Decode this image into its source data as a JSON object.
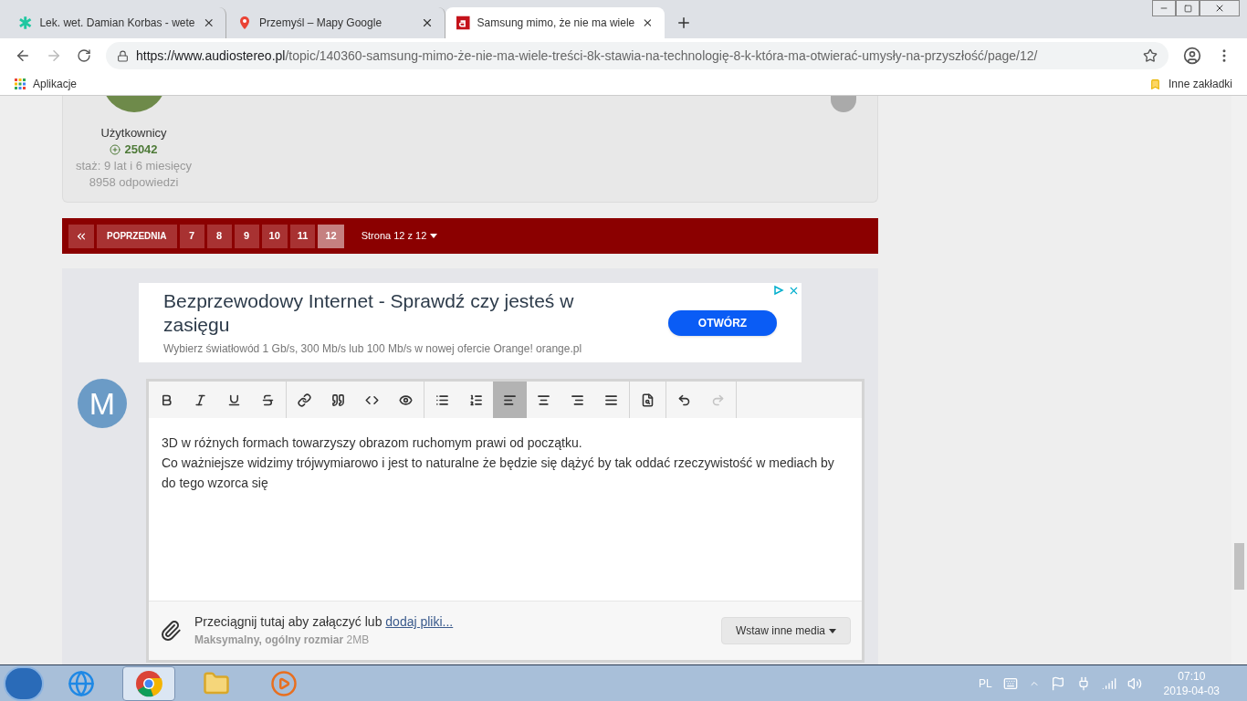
{
  "browser": {
    "tabs": [
      {
        "title": "Lek. wet. Damian Korbas - wete",
        "kind": "vet",
        "selected": false
      },
      {
        "title": "Przemyśl – Mapy Google",
        "kind": "maps",
        "selected": false
      },
      {
        "title": "Samsung mimo, że nie ma wiele",
        "kind": "site",
        "selected": true
      }
    ],
    "url_host": "https://www.audiostereo.pl",
    "url_path": "/topic/140360-samsung-mimo-że-nie-ma-wiele-treści-8k-stawia-na-technologię-8-k-która-ma-otwierać-umysły-na-przyszłość/page/12/",
    "bookmarks": [
      {
        "label": "Aplikacje",
        "kind": "apps"
      }
    ],
    "other_bookmarks": "Inne zakładki"
  },
  "user_card": {
    "group": "Użytkownicy",
    "reputation": "25042",
    "tenure": "staż: 9 lat i 6 miesięcy",
    "replies": "8958 odpowiedzi"
  },
  "pagination": {
    "prev": "POPRZEDNIA",
    "pages": [
      {
        "label": "7",
        "selected": false
      },
      {
        "label": "8",
        "selected": false
      },
      {
        "label": "9",
        "selected": false
      },
      {
        "label": "10",
        "selected": false
      },
      {
        "label": "11",
        "selected": false
      },
      {
        "label": "12",
        "selected": true
      }
    ],
    "page_info": "Strona 12 z 12"
  },
  "ad": {
    "title": "Bezprzewodowy Internet - Sprawdź czy jesteś w zasięgu",
    "text": "Wybierz światłowód 1 Gb/s, 300 Mb/s lub 100 Mb/s w nowej ofercie Orange! orange.pl",
    "button": "OTWÓRZ"
  },
  "editor": {
    "avatar_letter": "M",
    "toolbar": [
      [
        {
          "kind": "bold",
          "selected": false,
          "disabled": false
        },
        {
          "kind": "italic",
          "selected": false,
          "disabled": false
        },
        {
          "kind": "underline",
          "selected": false,
          "disabled": false
        },
        {
          "kind": "strike",
          "selected": false,
          "disabled": false
        }
      ],
      [
        {
          "kind": "link",
          "selected": false,
          "disabled": false
        },
        {
          "kind": "quote",
          "selected": false,
          "disabled": false
        },
        {
          "kind": "code",
          "selected": false,
          "disabled": false
        },
        {
          "kind": "spoiler",
          "selected": false,
          "disabled": false
        }
      ],
      [
        {
          "kind": "bullets",
          "selected": false,
          "disabled": false
        },
        {
          "kind": "numbers",
          "selected": false,
          "disabled": false
        },
        {
          "kind": "align_left",
          "selected": true,
          "disabled": false
        },
        {
          "kind": "align_center",
          "selected": false,
          "disabled": false
        },
        {
          "kind": "align_right",
          "selected": false,
          "disabled": false
        },
        {
          "kind": "justify",
          "selected": false,
          "disabled": false
        }
      ],
      [
        {
          "kind": "preview",
          "selected": false,
          "disabled": false
        }
      ],
      [
        {
          "kind": "undo",
          "selected": false,
          "disabled": false
        },
        {
          "kind": "redo",
          "selected": false,
          "disabled": true
        }
      ]
    ],
    "lines": [
      "3D w różnych formach towarzyszy obrazom ruchomym prawi od początku.",
      "Co ważniejsze widzimy trójwymiarowo i jest to naturalne że będzie się dążyć by tak oddać rzeczywistość w mediach by do tego wzorca się"
    ],
    "attach_text": "Przeciągnij tutaj aby załączyć lub",
    "attach_link": "dodaj pliki...",
    "limit_label": "Maksymalny, ogólny rozmiar",
    "limit_value": "2MB",
    "media_button": "Wstaw inne media"
  },
  "taskbar": {
    "apps": [
      {
        "kind": "ie",
        "selected": false
      },
      {
        "kind": "chrome",
        "selected": true
      },
      {
        "kind": "explorer",
        "selected": false
      },
      {
        "kind": "player",
        "selected": false
      }
    ],
    "language": "PL",
    "time": "07:10",
    "date": "2019-04-03"
  }
}
